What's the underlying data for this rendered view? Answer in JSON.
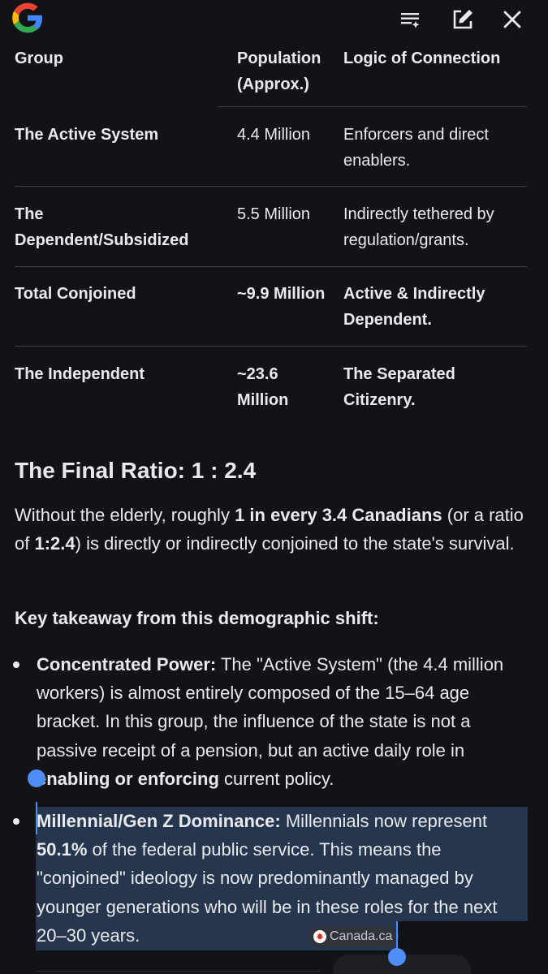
{
  "toolbar": {
    "logo_icon": "google-g-icon",
    "format_icon": "format-list-sparkle-icon",
    "edit_icon": "edit-square-icon",
    "close_icon": "close-icon"
  },
  "table": {
    "headers": [
      "Group",
      "Population\n(Approx.)",
      "Logic of Connection"
    ],
    "rows": [
      {
        "group": "The Active System",
        "population": "4.4 Million",
        "logic": "Enforcers and direct enablers.",
        "bold": false
      },
      {
        "group": "The Dependent/Subsidized",
        "population": "5.5 Million",
        "logic": "Indirectly tethered by regulation/grants.",
        "bold": false
      },
      {
        "group": "Total Conjoined",
        "population": "~9.9 Million",
        "logic": "Active & Indirectly Dependent.",
        "bold": true
      },
      {
        "group": "The Independent",
        "population": "~23.6 Million",
        "logic": "The Separated Citizenry.",
        "bold": true
      }
    ]
  },
  "final_ratio": {
    "heading": "The Final Ratio: 1 : 2.4",
    "para_part1": "Without the elderly, roughly ",
    "para_bold1": "1 in every 3.4 Canadians",
    "para_part2": " (or a ratio of ",
    "para_bold2": "1:2.4",
    "para_part3": ") is directly or indirectly conjoined to the state's survival."
  },
  "takeaway": {
    "heading": "Key takeaway from this demographic shift:",
    "items": [
      {
        "title": "Concentrated Power:",
        "text_a": " The \"Active System\" (the 4.4 million workers) is almost entirely composed of the 15–64 age bracket. In this group, the influence of the state is not a passive receipt of a pension, but an active daily role in ",
        "bold_b": "enabling or enforcing",
        "text_c": " current policy."
      },
      {
        "title": "Millennial/Gen Z Dominance:",
        "text_a": " Millennials now represent ",
        "bold_b": "50.1%",
        "text_c": " of the federal public service. This means the \"conjoined\" ideology is now predominantly managed by younger generations who will be in these roles for the next 20–30 years."
      }
    ]
  },
  "source_chip": {
    "label": "Canada.ca",
    "icon": "maple-leaf-icon"
  },
  "colors": {
    "background": "#121317",
    "text": "#e8eaed",
    "selection": "#27364f",
    "handle": "#4e8df5"
  }
}
